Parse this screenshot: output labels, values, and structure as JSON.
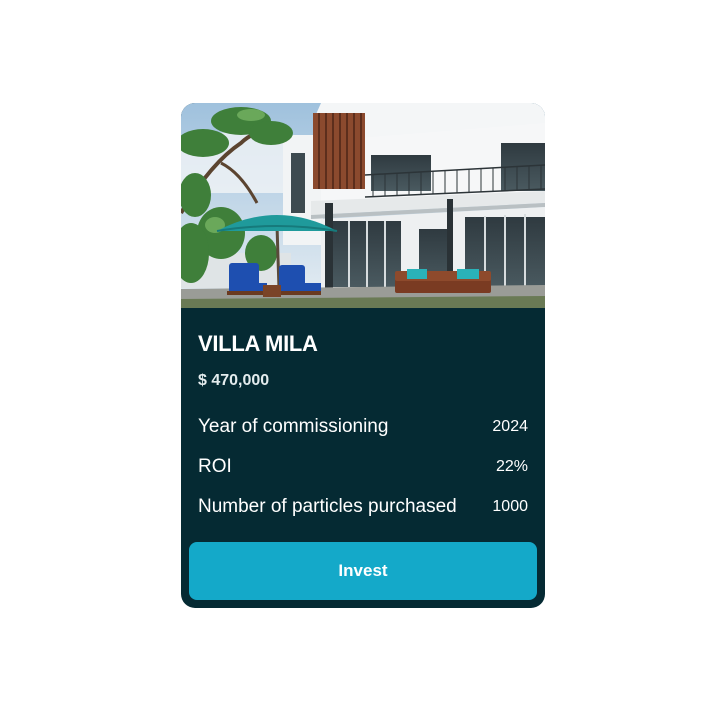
{
  "card": {
    "image_alt": "Villa Mila exterior with pool loungers and umbrella",
    "title": "VILLA MILA",
    "price": "$ 470,000",
    "details": [
      {
        "label": "Year of commissioning",
        "value": "2024"
      },
      {
        "label": "ROI",
        "value": "22%"
      },
      {
        "label": "Number of particles purchased",
        "value": "1000"
      }
    ],
    "cta_label": "Invest"
  },
  "colors": {
    "card_background": "#052a33",
    "button": "#14a9c9",
    "text": "#ffffff"
  }
}
